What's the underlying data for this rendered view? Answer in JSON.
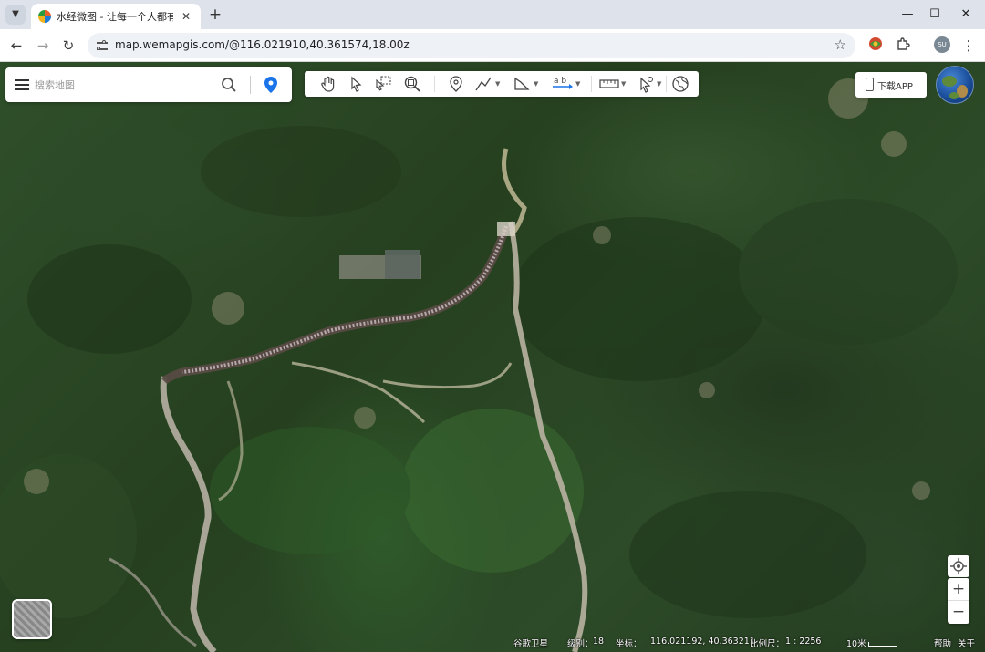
{
  "browser": {
    "tab_title": "水经微图 - 让每一个人都有自己",
    "url": "map.wemapgis.com/@116.021910,40.361574,18.00z",
    "profile_initials": "SU"
  },
  "map": {
    "search_placeholder": "搜索地图",
    "download_label": "下载APP",
    "layer_name": "谷歌卫星",
    "zoom_level_label": "级别：",
    "zoom_level": "18",
    "coord_label": "坐标：",
    "coordinates": "116.021192, 40.363211",
    "scale_label": "比例尺：",
    "scale": "1 : 2256",
    "scale_bar_label": "10米",
    "help_label": "帮助",
    "about_label": "关于"
  },
  "icons": {
    "tool_icons": [
      "hand-pan-icon",
      "pointer-select-icon",
      "box-select-icon",
      "zoom-area-icon",
      "marker-icon",
      "polyline-icon",
      "polygon-icon",
      "text-label-icon",
      "measure-ruler-icon",
      "pointer-info-icon",
      "globe-icon"
    ]
  },
  "colors": {
    "accent": "#1a73e8",
    "map_vegetation": "#2f4f2a"
  }
}
